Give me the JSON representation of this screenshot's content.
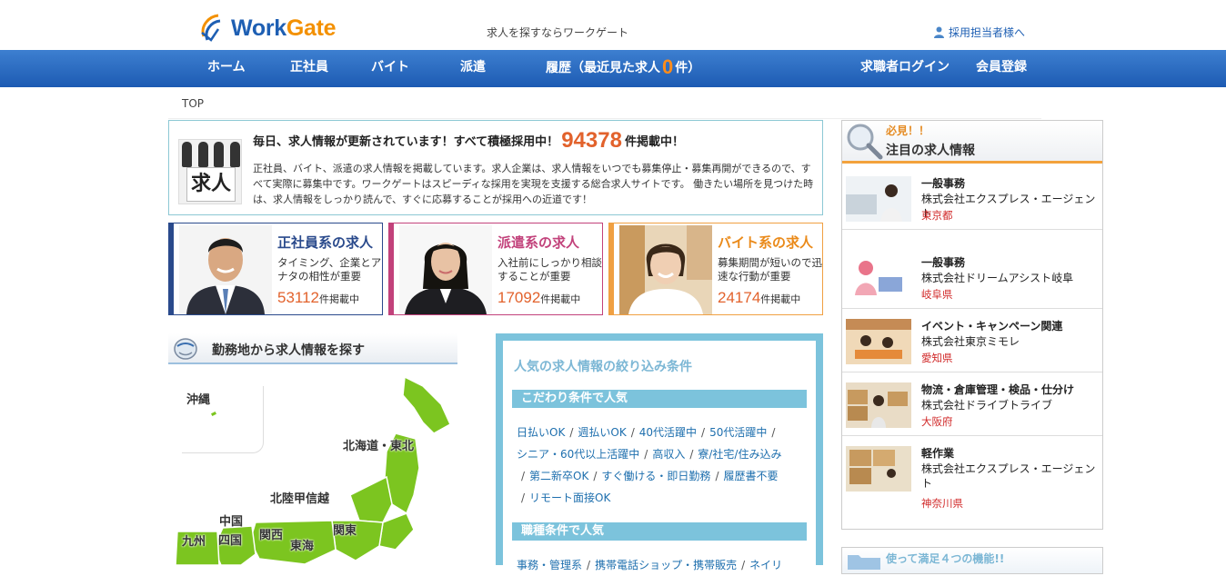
{
  "header": {
    "logo_text_work": "Work",
    "logo_text_gate": "Gate",
    "tagline": "求人を探すならワークゲート",
    "recruiter_link": "採用担当者様へ"
  },
  "nav": {
    "home": "ホーム",
    "seishain": "正社員",
    "baito": "バイト",
    "haken": "派遣",
    "history_prefix": "履歴（最近見た求人",
    "history_count": "0",
    "history_suffix": "件）",
    "login": "求職者ログイン",
    "register": "会員登録"
  },
  "breadcrumb": "TOP",
  "info": {
    "sign": "求人",
    "headline_prefix": "毎日、求人情報が更新されています！すべて積極採用中！",
    "total_count": "94378",
    "headline_suffix": "件掲載中！",
    "description": "正社員、バイト、派遣の求人情報を掲載しています。求人企業は、求人情報をいつでも募集停止・募集再開ができるので、すべて実際に募集中です。ワークゲートはスピーディな採用を実現を支援する総合求人サイトです。 働きたい場所を見つけた時は、求人情報をしっかり読んで、すぐに応募することが採用への近道です！"
  },
  "categories": [
    {
      "title": "正社員系の求人",
      "desc": "タイミング、企業とアナタの相性が重要",
      "count": "53112",
      "unit": "件掲載中"
    },
    {
      "title": "派遣系の求人",
      "desc": "入社前にしっかり相談することが重要",
      "count": "17092",
      "unit": "件掲載中"
    },
    {
      "title": "バイト系の求人",
      "desc": "募集期間が短いので迅速な行動が重要",
      "count": "24174",
      "unit": "件掲載中"
    }
  ],
  "area": {
    "heading": "勤務地から求人情報を探す",
    "regions": {
      "okinawa": "沖縄",
      "hokkaido_tohoku": "北海道・東北",
      "hokuriku": "北陸甲信越",
      "kanto": "関東",
      "tokai": "東海",
      "kansai": "関西",
      "chugoku": "中国",
      "shikoku": "四国",
      "kyushu": "九州"
    }
  },
  "filter": {
    "title": "人気の求人情報の絞り込み条件",
    "section1": "こだわり条件で人気",
    "tags_line1": [
      "日払いOK",
      "週払いOK",
      "40代活躍中",
      "50代活躍中"
    ],
    "tags_line2": [
      "シニア・60代以上活躍中",
      "高収入",
      "寮/社宅/住み込み"
    ],
    "tags_line3": [
      "第二新卒OK",
      "すぐ働ける・即日勤務",
      "履歴書不要"
    ],
    "tags_line4": [
      "リモート面接OK"
    ],
    "section2": "職種条件で人気",
    "tags_line5": [
      "事務・管理系",
      "携帯電話ショップ・携帯販売",
      "ネイリ"
    ]
  },
  "featured": {
    "must": "必見！！",
    "heading": "注目の求人情報",
    "jobs": [
      {
        "title": "一般事務",
        "company": "株式会社エクスプレス・エージェント",
        "location": "東京都"
      },
      {
        "title": "一般事務",
        "company": "株式会社ドリームアシスト岐阜",
        "location": "岐阜県"
      },
      {
        "title": "イベント・キャンペーン関連",
        "company": "株式会社東京ミモレ",
        "location": "愛知県"
      },
      {
        "title": "物流・倉庫管理・検品・仕分け",
        "company": "株式会社ドライブトライブ",
        "location": "大阪府"
      },
      {
        "title": "軽作業",
        "company": "株式会社エクスプレス・エージェント",
        "location": "神奈川県"
      }
    ]
  },
  "features_box": {
    "heading": "使って満足４つの機能!!"
  },
  "colors": {
    "nav_blue": "#2563b8",
    "accent_orange": "#e2622c",
    "seishain": "#2a4a8c",
    "haken": "#c2427b",
    "baito": "#ea8a1a",
    "filter_blue": "#7cc3dc",
    "location_red": "#d12a2a"
  }
}
